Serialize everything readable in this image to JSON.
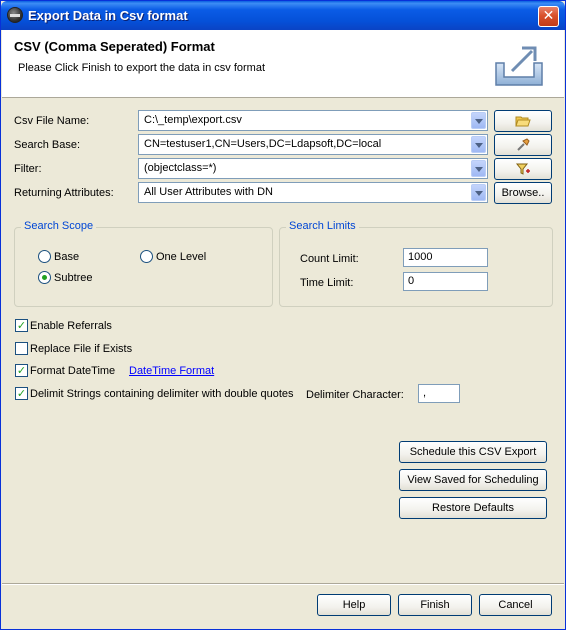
{
  "window": {
    "title": "Export Data in Csv format",
    "close_glyph": "✕"
  },
  "header": {
    "title": "CSV (Comma Seperated) Format",
    "subtitle": "Please Click Finish to export the data in csv format",
    "icon": "export-icon"
  },
  "form": {
    "csv_file_name_label": "Csv File Name:",
    "csv_file_name_value": "C:\\_temp\\export.csv",
    "search_base_label": "Search Base:",
    "search_base_value": "CN=testuser1,CN=Users,DC=Ldapsoft,DC=local",
    "filter_label": "Filter:",
    "filter_value": "(objectclass=*)",
    "returning_attributes_label": "Returning Attributes:",
    "returning_attributes_value": "All User Attributes with DN",
    "browse_label": "Browse.."
  },
  "search_scope": {
    "title": "Search Scope",
    "base_label": "Base",
    "one_level_label": "One Level",
    "subtree_label": "Subtree",
    "selected": "Subtree"
  },
  "search_limits": {
    "title": "Search Limits",
    "count_limit_label": "Count Limit:",
    "count_limit_value": "1000",
    "time_limit_label": "Time Limit:",
    "time_limit_value": "0"
  },
  "options": {
    "enable_referrals_label": "Enable Referrals",
    "enable_referrals_checked": true,
    "replace_file_label": "Replace File if Exists",
    "replace_file_checked": false,
    "format_datetime_label": "Format DateTime",
    "format_datetime_checked": true,
    "datetime_format_link": "DateTime Format",
    "delimit_strings_label": "Delimit Strings containing delimiter with double quotes",
    "delimit_strings_checked": true,
    "delimiter_character_label": "Delimiter Character:",
    "delimiter_character_value": ","
  },
  "actions": {
    "schedule_label": "Schedule this CSV Export",
    "view_saved_label": "View Saved for Scheduling",
    "restore_defaults_label": "Restore Defaults"
  },
  "footer": {
    "help_label": "Help",
    "finish_label": "Finish",
    "cancel_label": "Cancel"
  },
  "colors": {
    "titlebar": "#0550d8",
    "group_title": "#0046d5",
    "link": "#0000ff",
    "window_bg": "#ece9d8"
  }
}
